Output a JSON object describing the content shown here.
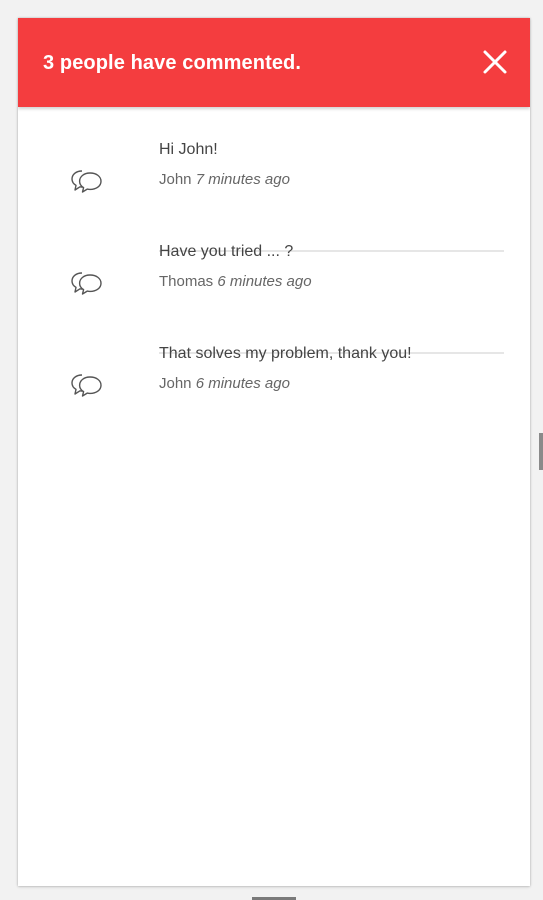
{
  "header": {
    "title": "3 people have commented.",
    "background_color": "#f43d3f",
    "close_icon": "close-icon"
  },
  "comments": [
    {
      "text": "Hi John!",
      "author": "John",
      "time": "7 minutes ago",
      "icon": "speech-bubbles-icon"
    },
    {
      "text": "Have you tried ... ?",
      "author": "Thomas",
      "time": "6 minutes ago",
      "icon": "speech-bubbles-icon"
    },
    {
      "text": "That solves my problem, thank you!",
      "author": "John",
      "time": "6 minutes ago",
      "icon": "speech-bubbles-icon"
    }
  ]
}
